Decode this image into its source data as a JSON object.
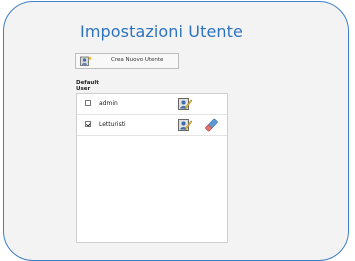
{
  "page": {
    "title": "Impostazioni Utente"
  },
  "toolbar": {
    "create_user_label": "Crea Nuovo Utente"
  },
  "group": {
    "label_line1": "Default",
    "label_line2": "User"
  },
  "users": [
    {
      "name": "admin",
      "checked": false,
      "can_delete": false
    },
    {
      "name": "Letturisti",
      "checked": true,
      "can_delete": true
    }
  ],
  "colors": {
    "accent": "#2d73c0",
    "panel_border": "#3f7fc4",
    "panel_bg": "#f3f3f3"
  }
}
